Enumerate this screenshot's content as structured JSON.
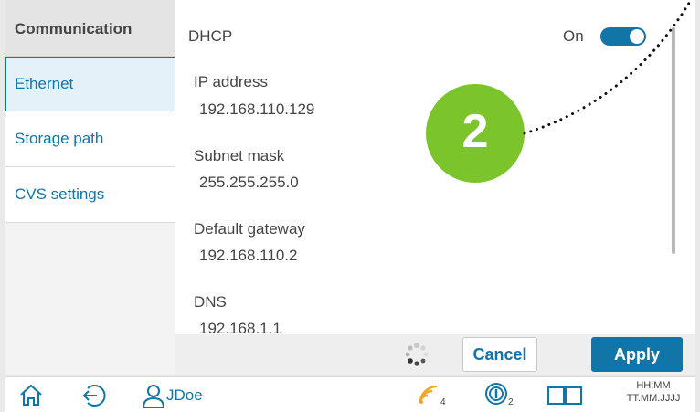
{
  "sidebar": {
    "header": "Communication",
    "items": [
      {
        "label": "Ethernet",
        "active": true
      },
      {
        "label": "Storage path",
        "active": false
      },
      {
        "label": "CVS settings",
        "active": false
      }
    ]
  },
  "main": {
    "dhcp_label": "DHCP",
    "dhcp_state": "On",
    "dhcp_enabled": true,
    "fields": [
      {
        "label": "IP address",
        "value": "192.168.110.129"
      },
      {
        "label": "Subnet mask",
        "value": "255.255.255.0"
      },
      {
        "label": "Default gateway",
        "value": "192.168.110.2"
      },
      {
        "label": "DNS",
        "value": "192.168.1.1"
      }
    ],
    "callout_number": "2"
  },
  "actions": {
    "cancel_label": "Cancel",
    "apply_label": "Apply"
  },
  "statusbar": {
    "user": "JDoe",
    "signal_count": "4",
    "info_count": "2",
    "time": "HH:MM",
    "date": "TT.MM.JJJJ"
  },
  "colors": {
    "accent": "#1175a8",
    "badge": "#7cc42c",
    "signal": "#f5a623"
  },
  "icons": [
    "home-icon",
    "logout-icon",
    "user-icon",
    "signal-icon",
    "info-icon",
    "book-icon",
    "spinner-icon"
  ]
}
